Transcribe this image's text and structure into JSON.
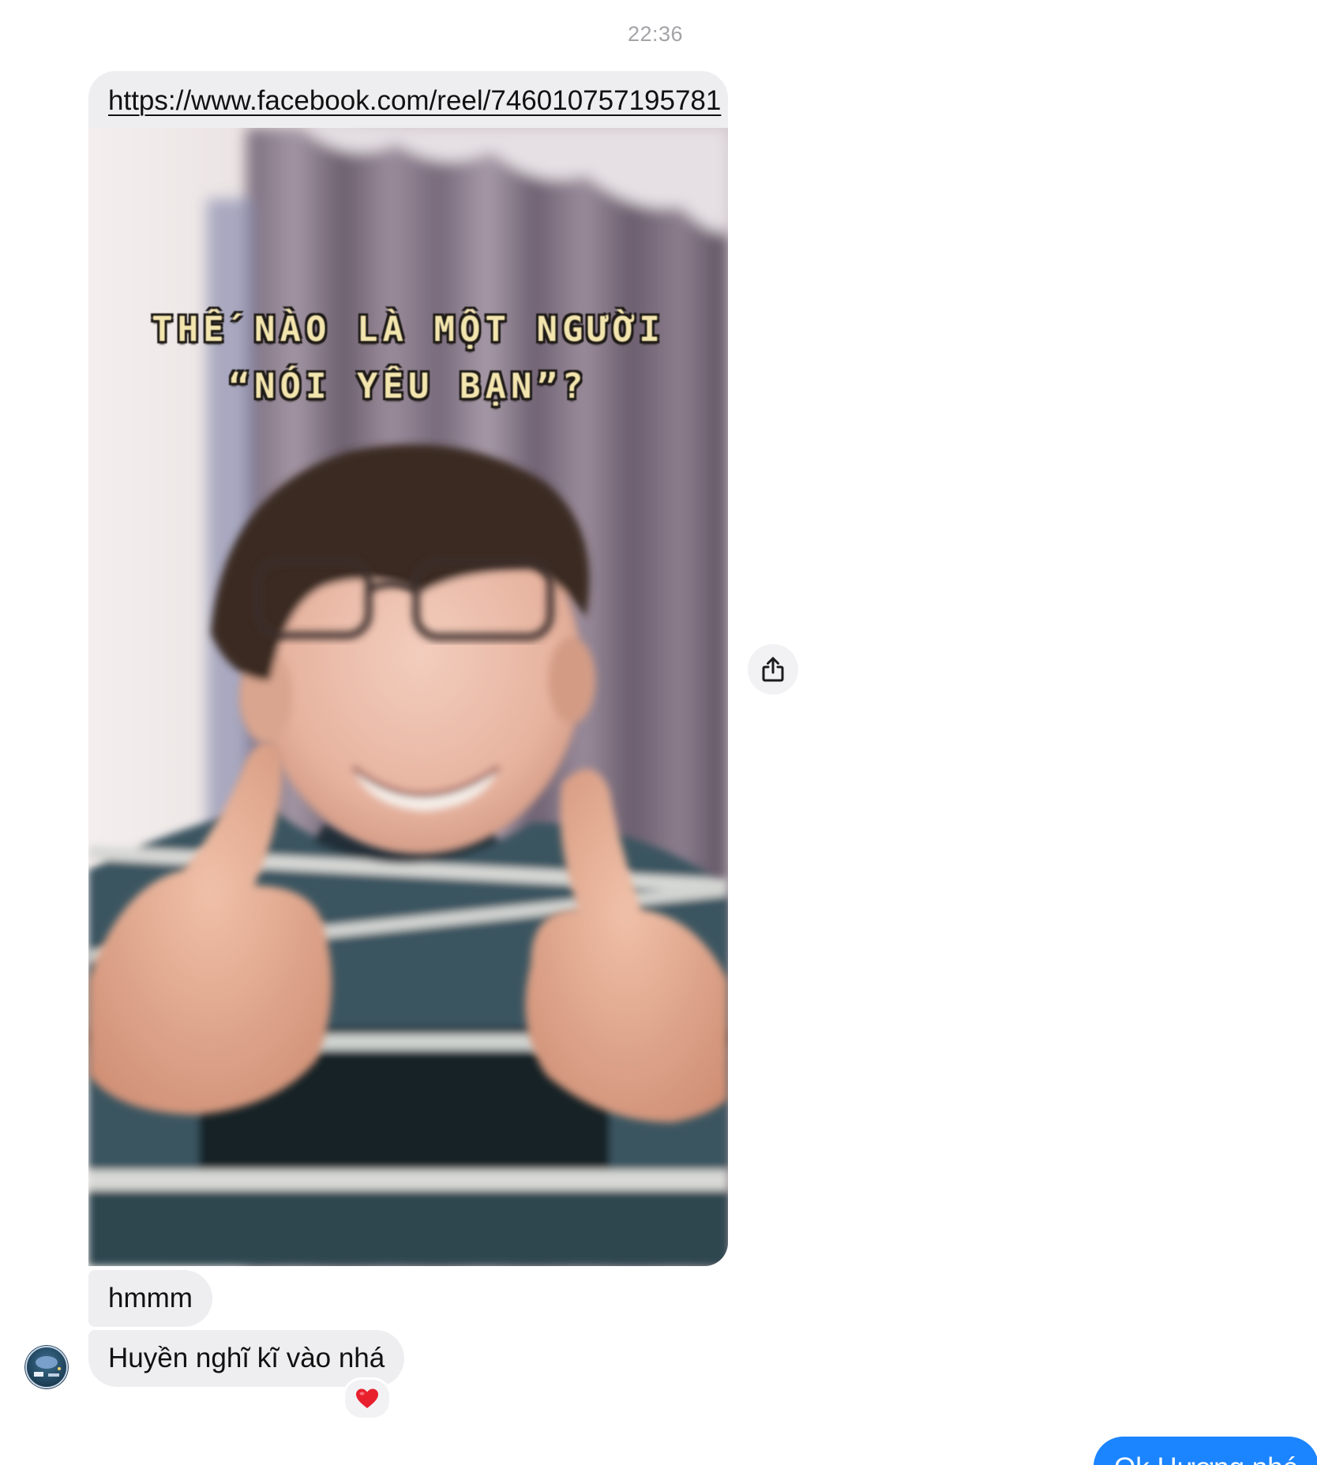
{
  "conversation": {
    "timestamp": "22:36"
  },
  "shared_link": {
    "url": "https://www.facebook.com/reel/746010757195781",
    "preview_caption_line1": "THẾ NÀO LÀ MỘT NGƯỜI",
    "preview_caption_line2": "“NÓI YÊU BẠN”?",
    "share_icon": "share-icon"
  },
  "incoming_messages": [
    {
      "text": "hmmm"
    },
    {
      "text": "Huyền nghĩ kĩ vào nhá",
      "reaction": "❤️"
    }
  ],
  "outgoing_messages": [
    {
      "text": "Ok Hương nhé"
    }
  ],
  "colors": {
    "incoming_bubble": "#eeeef0",
    "outgoing_bubble": "#1b84ff",
    "timestamp": "#a3a3a8",
    "reaction_heart": "#e8202e"
  }
}
